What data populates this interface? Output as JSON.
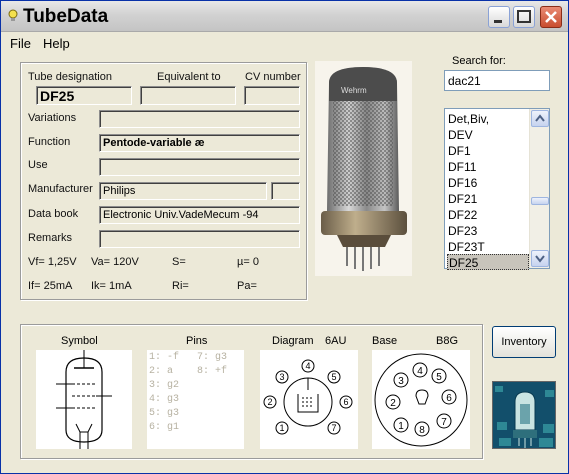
{
  "window": {
    "title": "TubeData"
  },
  "menu": {
    "file": "File",
    "help": "Help"
  },
  "header_labels": {
    "tube_designation": "Tube designation",
    "equivalent_to": "Equivalent to",
    "cv_number": "CV number"
  },
  "tube": {
    "designation": "DF25",
    "equivalent_to": "",
    "cv_number": "",
    "variations_label": "Variations",
    "variations": "",
    "function_label": "Function",
    "function": "Pentode-variable æ",
    "use_label": "Use",
    "use": "",
    "manufacturer_label": "Manufacturer",
    "manufacturer": "Philips",
    "manufacturer_extra": "",
    "databook_label": "Data book",
    "databook": "Electronic Univ.VadeMecum -94",
    "remarks_label": "Remarks",
    "remarks": ""
  },
  "params": {
    "vf": "Vf= 1,25V",
    "va": "Va= 120V",
    "s": "S=",
    "mu": "µ=   0",
    "if": "If= 25mA",
    "ik": "Ik=  1mA",
    "ri": "Ri=",
    "pa": "Pa="
  },
  "search": {
    "label": "Search for:",
    "value": "dac21"
  },
  "tube_list": [
    "Det,Biv,",
    "DEV",
    "DF1",
    "DF11",
    "DF16",
    "DF21",
    "DF22",
    "DF23",
    "DF23T",
    "DF25"
  ],
  "selected_tube": "DF25",
  "bottom": {
    "symbol_label": "Symbol",
    "pins_label": "Pins",
    "diagram_label": "Diagram",
    "diagram_code": "6AU",
    "base_label": "Base",
    "base_code": "B8G",
    "pins_col1": [
      "1: -f",
      "2: a",
      "3: g2",
      "4: g3",
      "5: g3",
      "6: g1"
    ],
    "pins_col2": [
      "7: g3",
      "8: +f"
    ],
    "diagram_pins": [
      "1",
      "2",
      "3",
      "4",
      "5",
      "6",
      "7"
    ],
    "base_pins": [
      "1",
      "2",
      "3",
      "4",
      "5",
      "6",
      "7",
      "8"
    ]
  },
  "buttons": {
    "inventory": "Inventory"
  },
  "icons": [
    "lightbulb-icon",
    "minimize-icon",
    "maximize-icon",
    "close-icon",
    "scroll-up-icon",
    "scroll-down-icon"
  ],
  "colors": {
    "close_button": "#c94d2f",
    "selection": "#c8c4bb",
    "border_accent": "#0831a8"
  }
}
